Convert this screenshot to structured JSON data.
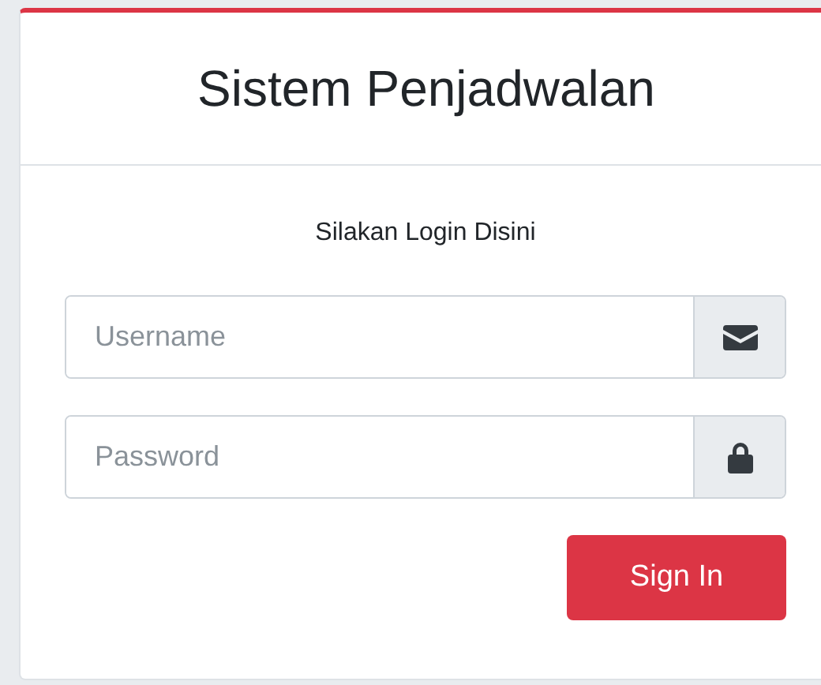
{
  "header": {
    "title": "Sistem Penjadwalan"
  },
  "form": {
    "message": "Silakan Login Disini",
    "fields": [
      {
        "kind": "username",
        "placeholder": "Username"
      },
      {
        "kind": "password",
        "placeholder": "Password"
      }
    ],
    "submit": "Sign In"
  }
}
